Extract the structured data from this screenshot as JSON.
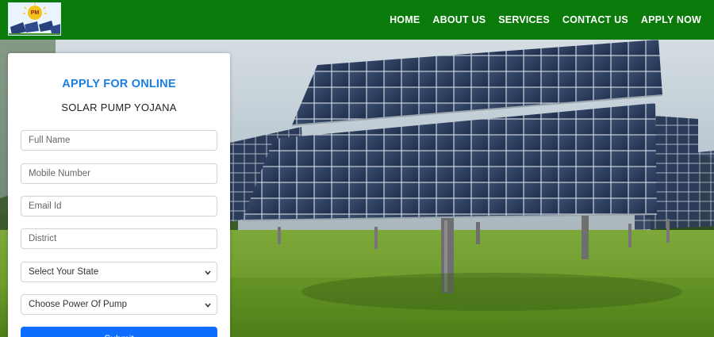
{
  "nav": {
    "logo_text": "PM",
    "items": [
      "HOME",
      "ABOUT US",
      "SERVICES",
      "CONTACT US",
      "APPLY NOW"
    ]
  },
  "form": {
    "title": "APPLY FOR ONLINE",
    "subtitle": "SOLAR PUMP YOJANA",
    "full_name_placeholder": "Full Name",
    "mobile_placeholder": "Mobile Number",
    "email_placeholder": "Email Id",
    "district_placeholder": "District",
    "state_select": "Select Your State",
    "pump_select": "Choose Power Of Pump",
    "submit_label": "Submit"
  },
  "colors": {
    "navbar": "#0a7a0a",
    "title_blue": "#1b7ee0",
    "submit_blue": "#0d6efd"
  },
  "icons": [
    "chevron-down-icon"
  ]
}
